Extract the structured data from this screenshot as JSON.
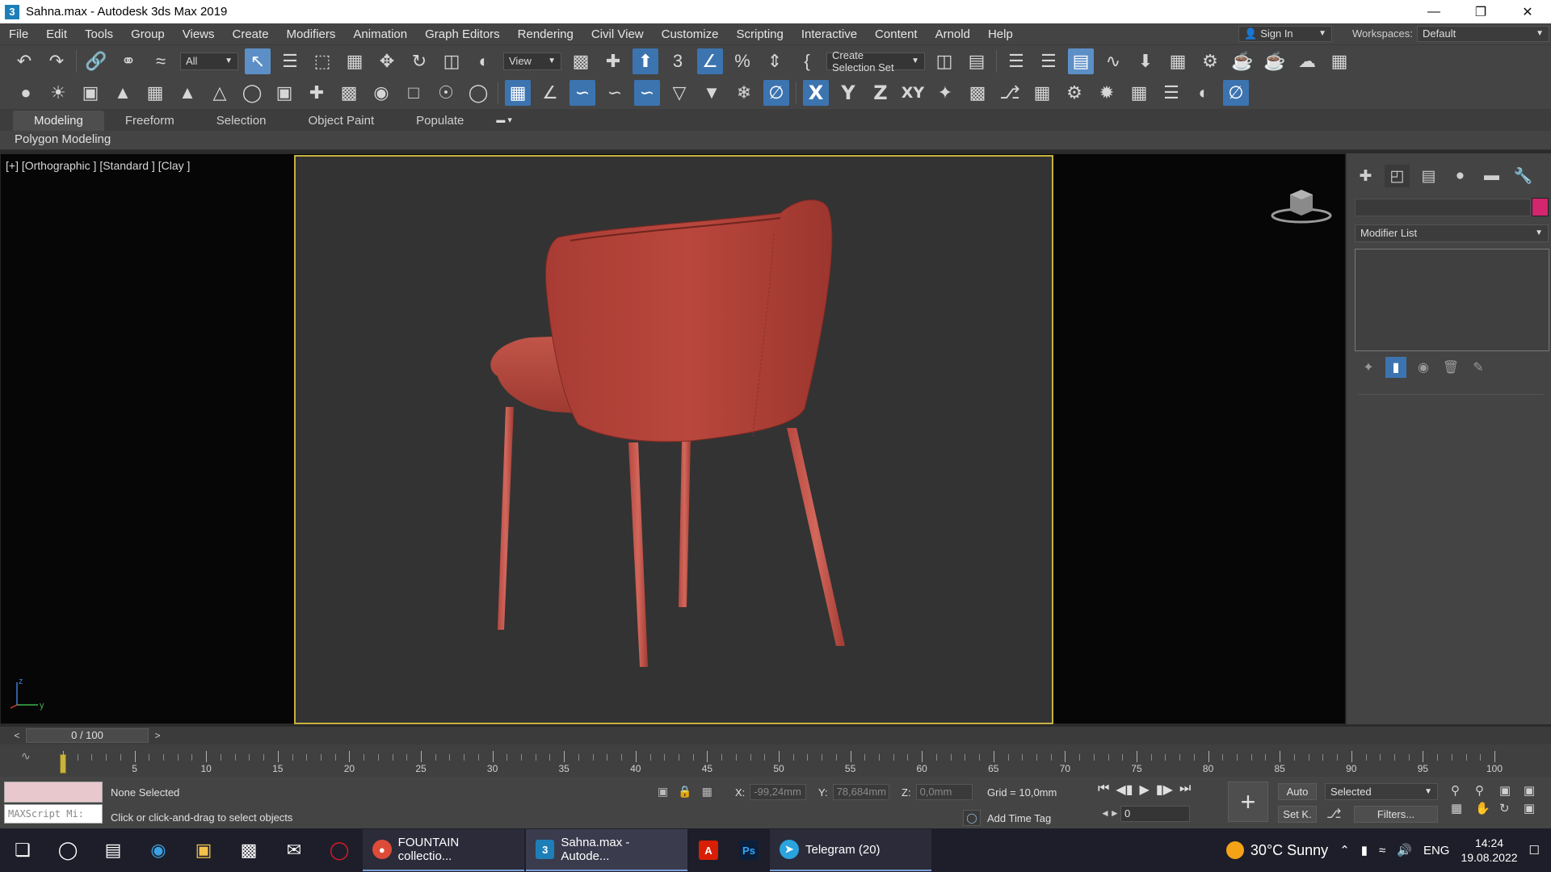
{
  "window": {
    "title": "Sahna.max - Autodesk 3ds Max 2019",
    "app_icon_glyph": "3",
    "controls": [
      "minimize-icon",
      "restore-icon",
      "close-icon"
    ]
  },
  "menu": {
    "items": [
      "File",
      "Edit",
      "Tools",
      "Group",
      "Views",
      "Create",
      "Modifiers",
      "Animation",
      "Graph Editors",
      "Rendering",
      "Civil View",
      "Customize",
      "Scripting",
      "Interactive",
      "Content",
      "Arnold",
      "Help"
    ],
    "sign_in": "Sign In",
    "workspaces_label": "Workspaces:",
    "workspace_value": "Default"
  },
  "toolbar1": {
    "filter_value": "All",
    "ref_coord_value": "View",
    "selection_set_placeholder": "Create Selection Set"
  },
  "toolbar2": {
    "axis_x": "X",
    "axis_y": "Y",
    "axis_z": "Z",
    "axis_xy": "XY"
  },
  "ribbon": {
    "tabs": [
      "Modeling",
      "Freeform",
      "Selection",
      "Object Paint",
      "Populate"
    ],
    "active_tab": "Modeling",
    "panel_title": "Polygon Modeling"
  },
  "viewport": {
    "label": "[+] [Orthographic ] [Standard ] [Clay ]",
    "axis_labels": [
      "z",
      "y"
    ],
    "object_color": "#b8463c",
    "safe_frame_color": "#c8b23e"
  },
  "command_panel": {
    "tabs": [
      "create-icon",
      "modify-icon",
      "hierarchy-icon",
      "motion-icon",
      "display-icon",
      "utilities-icon"
    ],
    "object_color": "#d4256f",
    "modifier_list_label": "Modifier List"
  },
  "timeline": {
    "frame_display": "0 / 100",
    "ticks": [
      "5",
      "10",
      "15",
      "20",
      "25",
      "30",
      "35",
      "40",
      "45",
      "50",
      "55",
      "60",
      "65",
      "70",
      "75",
      "80",
      "85",
      "90",
      "95",
      "100"
    ]
  },
  "status": {
    "maxscript_placeholder": "MAXScript Mi:",
    "selection_status": "None Selected",
    "prompt": "Click or click-and-drag to select objects",
    "x_label": "X:",
    "x_value": "-99,24mm",
    "y_label": "Y:",
    "y_value": "78,684mm",
    "z_label": "Z:",
    "z_value": "0,0mm",
    "grid": "Grid = 10,0mm",
    "add_time_tag": "Add Time Tag",
    "current_frame": "0",
    "auto_key": "Auto",
    "set_key": "Set K.",
    "key_filter_value": "Selected",
    "filters": "Filters..."
  },
  "taskbar": {
    "apps": [
      {
        "name": "FOUNTAIN collectio...",
        "icon": "chrome-icon"
      },
      {
        "name": "Sahna.max - Autode...",
        "icon": "3dsmax-icon"
      },
      {
        "name": "",
        "icon": "acrobat-icon"
      },
      {
        "name": "",
        "icon": "photoshop-icon"
      },
      {
        "name": "Telegram (20)",
        "icon": "telegram-icon"
      }
    ],
    "weather": "30°C  Sunny",
    "language": "ENG",
    "time": "14:24",
    "date": "19.08.2022",
    "telegram_badge": "20"
  }
}
